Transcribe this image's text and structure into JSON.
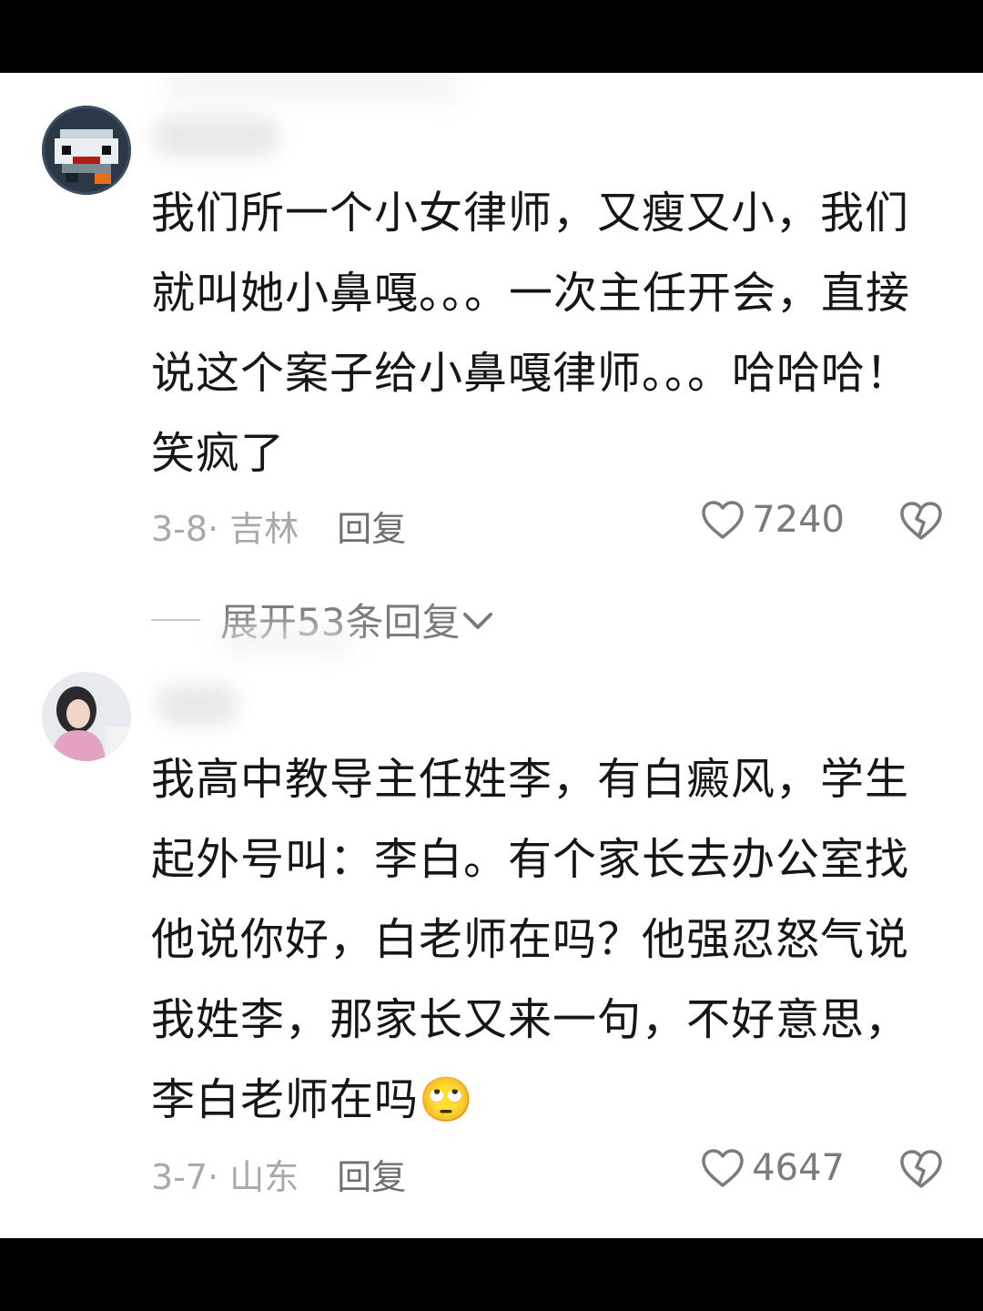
{
  "comments": [
    {
      "text": "我们所一个小女律师，又瘦又小，我们就叫她小鼻嘎。。。一次主任开会，直接说这个案子给小鼻嘎律师。。。哈哈哈！笑疯了",
      "date_location": "3-8· 吉林",
      "reply_label": "回复",
      "likes": "7240",
      "avatar_icon": "pixel-robot-avatar"
    },
    {
      "text": "我高中教导主任姓李，有白癜风，学生起外号叫：李白。有个家长去办公室找他说你好，白老师在吗？他强忍怒气说我姓李，那家长又来一句，不好意思，李白老师在吗",
      "emoji": "🙄",
      "date_location": "3-7· 山东",
      "reply_label": "回复",
      "likes": "4647",
      "avatar_icon": "girl-photo-avatar"
    }
  ],
  "expand_replies": {
    "label": "展开53条回复",
    "icon": "chevron-down-icon"
  },
  "icons": {
    "like": "heart-outline-icon",
    "dislike": "broken-heart-icon"
  },
  "colors": {
    "text": "#161616",
    "meta": "#a9a9a9",
    "secondary": "#7b7b7b",
    "background": "#ffffff"
  }
}
